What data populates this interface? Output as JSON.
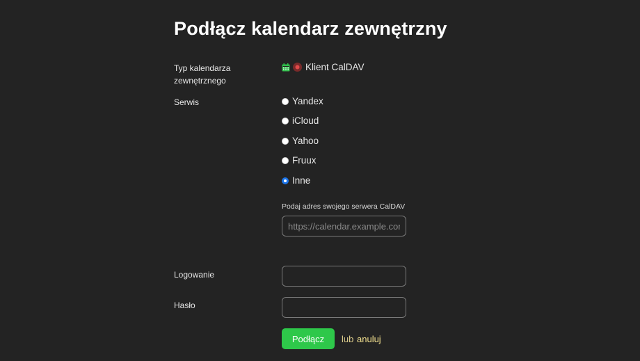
{
  "title": "Podłącz kalendarz zewnętrzny",
  "calendar_type": {
    "label": "Typ kalendarza zewnętrznego",
    "value": "Klient CalDAV",
    "icons": [
      "calendar-icon",
      "record-icon"
    ]
  },
  "service": {
    "label": "Serwis",
    "options": [
      {
        "label": "Yandex",
        "checked": false
      },
      {
        "label": "iCloud",
        "checked": false
      },
      {
        "label": "Yahoo",
        "checked": false
      },
      {
        "label": "Fruux",
        "checked": false
      },
      {
        "label": "Inne",
        "checked": true
      }
    ]
  },
  "server": {
    "hint": "Podaj adres swojego serwera CalDAV",
    "placeholder": "https://calendar.example.com",
    "value": ""
  },
  "login": {
    "label": "Logowanie",
    "value": ""
  },
  "password": {
    "label": "Hasło",
    "value": ""
  },
  "actions": {
    "connect_label": "Podłącz",
    "or_text": "lub",
    "cancel_label": "anuluj"
  },
  "colors": {
    "background": "#232323",
    "accent_green": "#2ec84a",
    "link_yellow": "#f2e08f",
    "radio_selected": "#1a73e8"
  }
}
